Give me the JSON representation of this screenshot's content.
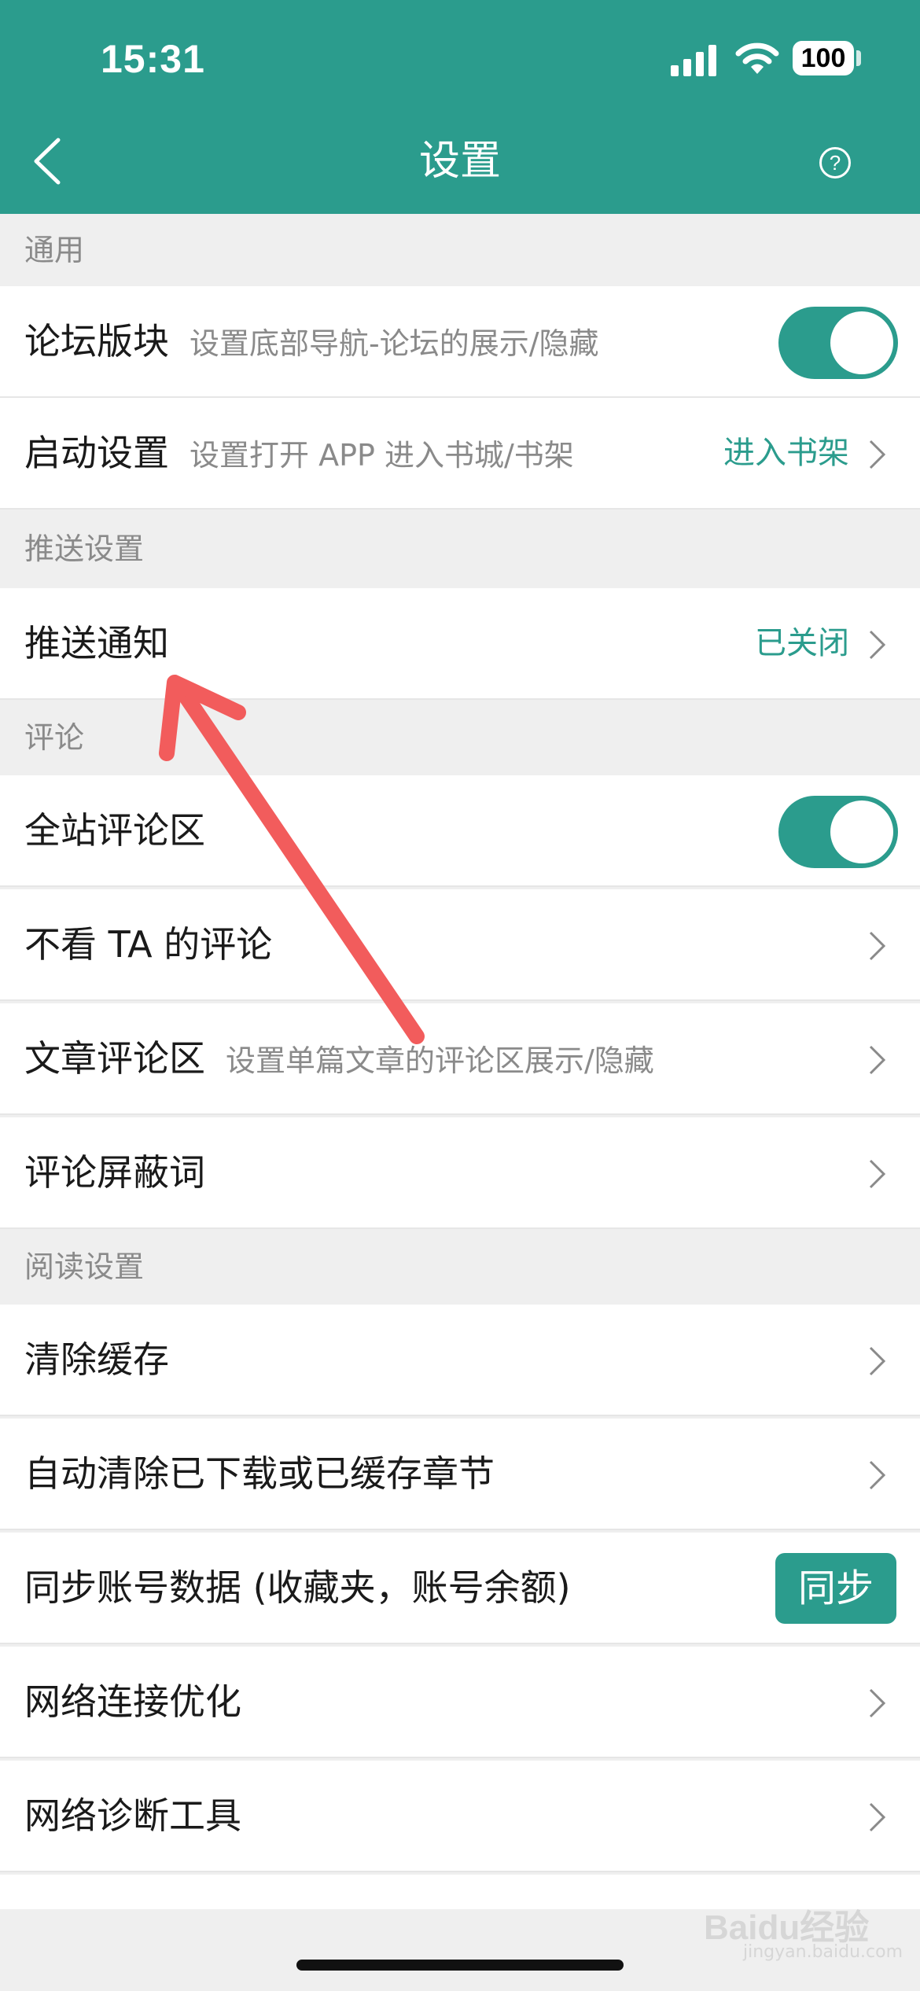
{
  "status_bar": {
    "time": "15:31",
    "battery": "100"
  },
  "nav": {
    "title": "设置",
    "help_glyph": "?"
  },
  "sections": {
    "general": "通用",
    "push": "推送设置",
    "comments": "评论",
    "reading": "阅读设置"
  },
  "rows": {
    "forum": {
      "label": "论坛版块",
      "desc": "设置底部导航-论坛的展示/隐藏",
      "toggle_on": true
    },
    "startup": {
      "label": "启动设置",
      "desc": "设置打开 APP 进入书城/书架",
      "value": "进入书架"
    },
    "push_notify": {
      "label": "推送通知",
      "value": "已关闭"
    },
    "site_comments": {
      "label": "全站评论区",
      "toggle_on": true
    },
    "block_ta": {
      "label": "不看 TA 的评论"
    },
    "article_comments": {
      "label": "文章评论区",
      "desc": "设置单篇文章的评论区展示/隐藏"
    },
    "block_words": {
      "label": "评论屏蔽词"
    },
    "clear_cache": {
      "label": "清除缓存"
    },
    "auto_clear": {
      "label": "自动清除已下载或已缓存章节"
    },
    "sync_account": {
      "label": "同步账号数据 (收藏夹，账号余额)",
      "button": "同步"
    },
    "network_opt": {
      "label": "网络连接优化"
    },
    "network_diag": {
      "label": "网络诊断工具"
    }
  },
  "watermark": {
    "brand": "Baidu经验",
    "url": "jingyan.baidu.com"
  },
  "colors": {
    "accent": "#2b9c8d",
    "annotation_arrow": "#f25c5c"
  }
}
